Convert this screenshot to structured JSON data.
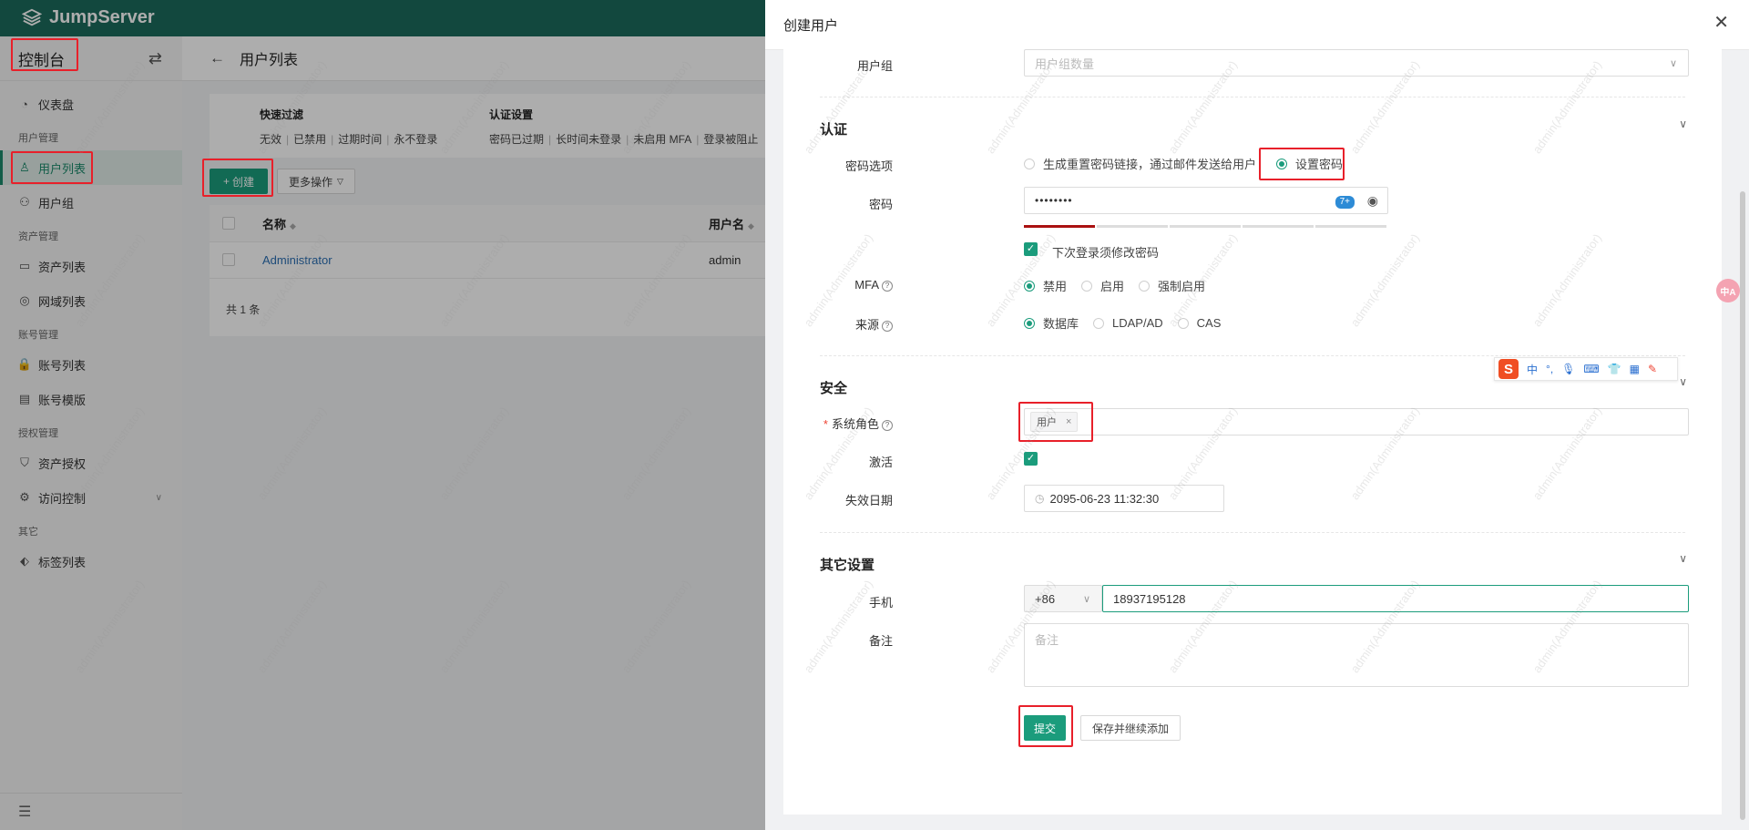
{
  "app": {
    "logo_text": "JumpServer"
  },
  "sidebar": {
    "console_title": "控制台",
    "items": [
      {
        "type": "item",
        "label": "仪表盘",
        "icon": "dashboard-icon"
      },
      {
        "type": "group",
        "label": "用户管理"
      },
      {
        "type": "item",
        "label": "用户列表",
        "icon": "user-icon",
        "active": true
      },
      {
        "type": "item",
        "label": "用户组",
        "icon": "user-group-icon"
      },
      {
        "type": "group",
        "label": "资产管理"
      },
      {
        "type": "item",
        "label": "资产列表",
        "icon": "monitor-icon"
      },
      {
        "type": "item",
        "label": "网域列表",
        "icon": "location-icon"
      },
      {
        "type": "group",
        "label": "账号管理"
      },
      {
        "type": "item",
        "label": "账号列表",
        "icon": "lock-icon"
      },
      {
        "type": "item",
        "label": "账号模版",
        "icon": "template-icon"
      },
      {
        "type": "group",
        "label": "授权管理"
      },
      {
        "type": "item",
        "label": "资产授权",
        "icon": "shield-icon"
      },
      {
        "type": "item",
        "label": "访问控制",
        "icon": "gear-icon",
        "has_arrow": true
      },
      {
        "type": "group",
        "label": "其它"
      },
      {
        "type": "item",
        "label": "标签列表",
        "icon": "tag-icon"
      }
    ]
  },
  "page": {
    "title": "用户列表",
    "quick_filter": {
      "title": "快速过滤",
      "links": [
        "无效",
        "已禁用",
        "过期时间",
        "永不登录"
      ]
    },
    "auth_filter": {
      "title": "认证设置",
      "links": [
        "密码已过期",
        "长时间未登录",
        "未启用 MFA",
        "登录被阻止"
      ]
    },
    "create_label": "创建",
    "more_label": "更多操作",
    "table": {
      "columns": [
        "名称",
        "用户名"
      ],
      "rows": [
        {
          "name": "Administrator",
          "username": "admin"
        }
      ],
      "total": "共 1 条"
    }
  },
  "drawer": {
    "title": "创建用户",
    "user_group": {
      "label": "用户组",
      "placeholder": "用户组数量"
    },
    "auth": {
      "title": "认证",
      "password_option_label": "密码选项",
      "password_option_reset": "生成重置密码链接，通过邮件发送给用户",
      "password_option_set": "设置密码",
      "password_label": "密码",
      "password_value": "••••••••",
      "password_badge": "7+",
      "password_strength_level": 1,
      "password_strength_total": 5,
      "must_change_label": "下次登录须修改密码",
      "mfa_label": "MFA",
      "mfa_options": [
        "禁用",
        "启用",
        "强制启用"
      ],
      "mfa_selected": 0,
      "source_label": "来源",
      "source_options": [
        "数据库",
        "LDAP/AD",
        "CAS"
      ],
      "source_selected": 0
    },
    "security": {
      "title": "安全",
      "role_label": "系统角色",
      "role_tag": "用户",
      "active_label": "激活",
      "expire_label": "失效日期",
      "expire_value": "2095-06-23 11:32:30"
    },
    "other": {
      "title": "其它设置",
      "phone_label": "手机",
      "phone_code": "+86",
      "phone_value": "18937195128",
      "note_label": "备注",
      "note_placeholder": "备注"
    },
    "submit_label": "提交",
    "save_continue_label": "保存并继续添加"
  },
  "ime": {
    "items": [
      "中",
      "°,",
      "mic",
      "kbd",
      "shirt",
      "grid",
      "tool"
    ]
  },
  "watermark": "admin(Administrator)",
  "colors": {
    "primary": "#1b9c7c",
    "topbar": "#1b6a5c",
    "highlight": "#e8202a",
    "link": "#2b6fb3"
  }
}
